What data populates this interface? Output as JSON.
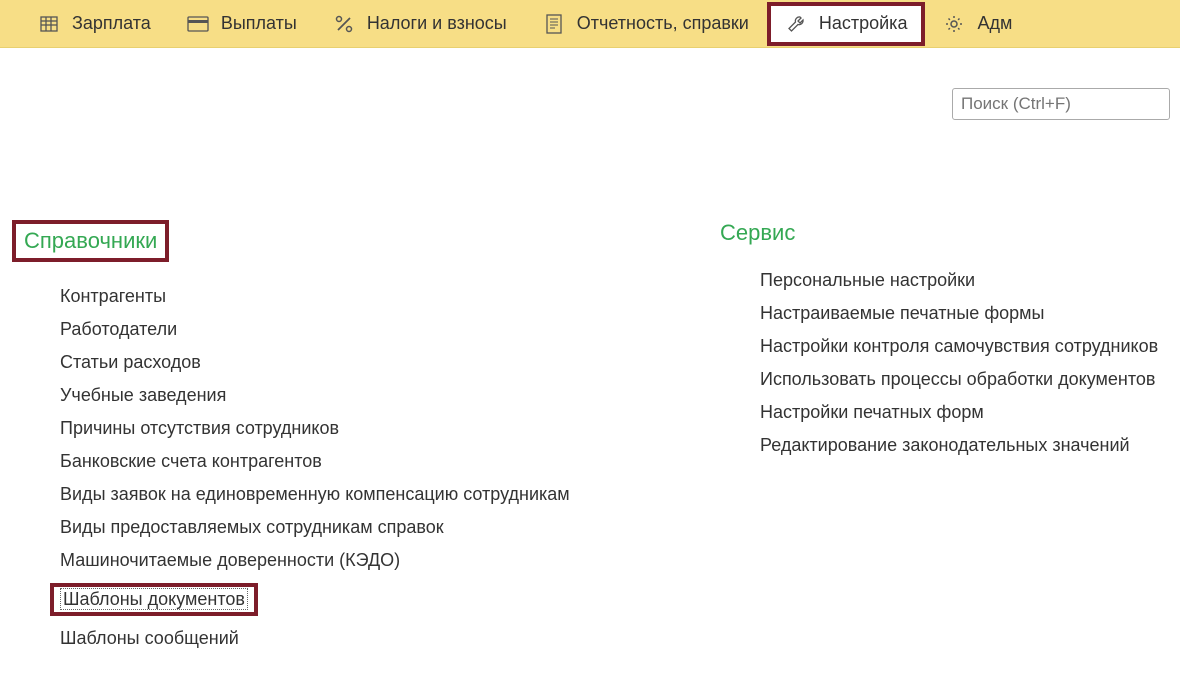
{
  "toolbar": {
    "items": [
      {
        "icon": "table",
        "label": "Зарплата"
      },
      {
        "icon": "card",
        "label": "Выплаты"
      },
      {
        "icon": "percent",
        "label": "Налоги и взносы"
      },
      {
        "icon": "doc",
        "label": "Отчетность, справки"
      },
      {
        "icon": "wrench",
        "label": "Настройка",
        "highlighted": true
      },
      {
        "icon": "gear",
        "label": "Адм",
        "partial": true
      }
    ]
  },
  "search": {
    "placeholder": "Поиск (Ctrl+F)"
  },
  "sections": {
    "left": {
      "title": "Справочники",
      "highlighted": true,
      "links": [
        "Контрагенты",
        "Работодатели",
        "Статьи расходов",
        "Учебные заведения",
        "Причины отсутствия сотрудников",
        "Банковские счета контрагентов",
        "Виды заявок на единовременную компенсацию сотрудникам",
        "Виды предоставляемых сотрудникам справок",
        "Машиночитаемые доверенности (КЭДО)",
        "Шаблоны документов",
        "Шаблоны сообщений"
      ],
      "highlighted_index": 9
    },
    "right": {
      "title": "Сервис",
      "links": [
        "Персональные настройки",
        "Настраиваемые печатные формы",
        "Настройки контроля самочувствия сотрудников",
        "Использовать процессы обработки документов",
        "Настройки печатных форм",
        "Редактирование законодательных значений"
      ]
    }
  }
}
